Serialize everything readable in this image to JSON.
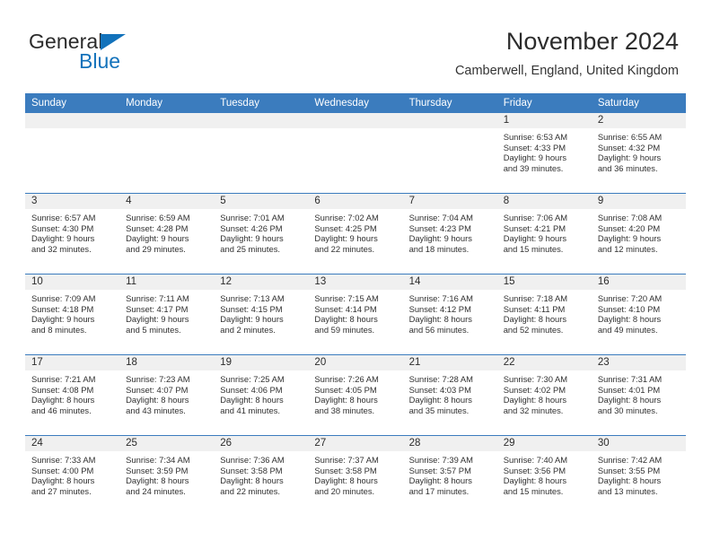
{
  "brand": {
    "name_part1": "General",
    "name_part2": "Blue",
    "logo_icon": "triangle-flag-icon",
    "accent_color": "#1272bb"
  },
  "header": {
    "title": "November 2024",
    "subtitle": "Camberwell, England, United Kingdom"
  },
  "calendar": {
    "header_bg_color": "#3b7cbe",
    "daynum_bg_color": "#f0f0f0",
    "weekday_headers": [
      "Sunday",
      "Monday",
      "Tuesday",
      "Wednesday",
      "Thursday",
      "Friday",
      "Saturday"
    ],
    "weeks": [
      [
        {
          "day": "",
          "details": ""
        },
        {
          "day": "",
          "details": ""
        },
        {
          "day": "",
          "details": ""
        },
        {
          "day": "",
          "details": ""
        },
        {
          "day": "",
          "details": ""
        },
        {
          "day": "1",
          "details": "Sunrise: 6:53 AM\nSunset: 4:33 PM\nDaylight: 9 hours\nand 39 minutes."
        },
        {
          "day": "2",
          "details": "Sunrise: 6:55 AM\nSunset: 4:32 PM\nDaylight: 9 hours\nand 36 minutes."
        }
      ],
      [
        {
          "day": "3",
          "details": "Sunrise: 6:57 AM\nSunset: 4:30 PM\nDaylight: 9 hours\nand 32 minutes."
        },
        {
          "day": "4",
          "details": "Sunrise: 6:59 AM\nSunset: 4:28 PM\nDaylight: 9 hours\nand 29 minutes."
        },
        {
          "day": "5",
          "details": "Sunrise: 7:01 AM\nSunset: 4:26 PM\nDaylight: 9 hours\nand 25 minutes."
        },
        {
          "day": "6",
          "details": "Sunrise: 7:02 AM\nSunset: 4:25 PM\nDaylight: 9 hours\nand 22 minutes."
        },
        {
          "day": "7",
          "details": "Sunrise: 7:04 AM\nSunset: 4:23 PM\nDaylight: 9 hours\nand 18 minutes."
        },
        {
          "day": "8",
          "details": "Sunrise: 7:06 AM\nSunset: 4:21 PM\nDaylight: 9 hours\nand 15 minutes."
        },
        {
          "day": "9",
          "details": "Sunrise: 7:08 AM\nSunset: 4:20 PM\nDaylight: 9 hours\nand 12 minutes."
        }
      ],
      [
        {
          "day": "10",
          "details": "Sunrise: 7:09 AM\nSunset: 4:18 PM\nDaylight: 9 hours\nand 8 minutes."
        },
        {
          "day": "11",
          "details": "Sunrise: 7:11 AM\nSunset: 4:17 PM\nDaylight: 9 hours\nand 5 minutes."
        },
        {
          "day": "12",
          "details": "Sunrise: 7:13 AM\nSunset: 4:15 PM\nDaylight: 9 hours\nand 2 minutes."
        },
        {
          "day": "13",
          "details": "Sunrise: 7:15 AM\nSunset: 4:14 PM\nDaylight: 8 hours\nand 59 minutes."
        },
        {
          "day": "14",
          "details": "Sunrise: 7:16 AM\nSunset: 4:12 PM\nDaylight: 8 hours\nand 56 minutes."
        },
        {
          "day": "15",
          "details": "Sunrise: 7:18 AM\nSunset: 4:11 PM\nDaylight: 8 hours\nand 52 minutes."
        },
        {
          "day": "16",
          "details": "Sunrise: 7:20 AM\nSunset: 4:10 PM\nDaylight: 8 hours\nand 49 minutes."
        }
      ],
      [
        {
          "day": "17",
          "details": "Sunrise: 7:21 AM\nSunset: 4:08 PM\nDaylight: 8 hours\nand 46 minutes."
        },
        {
          "day": "18",
          "details": "Sunrise: 7:23 AM\nSunset: 4:07 PM\nDaylight: 8 hours\nand 43 minutes."
        },
        {
          "day": "19",
          "details": "Sunrise: 7:25 AM\nSunset: 4:06 PM\nDaylight: 8 hours\nand 41 minutes."
        },
        {
          "day": "20",
          "details": "Sunrise: 7:26 AM\nSunset: 4:05 PM\nDaylight: 8 hours\nand 38 minutes."
        },
        {
          "day": "21",
          "details": "Sunrise: 7:28 AM\nSunset: 4:03 PM\nDaylight: 8 hours\nand 35 minutes."
        },
        {
          "day": "22",
          "details": "Sunrise: 7:30 AM\nSunset: 4:02 PM\nDaylight: 8 hours\nand 32 minutes."
        },
        {
          "day": "23",
          "details": "Sunrise: 7:31 AM\nSunset: 4:01 PM\nDaylight: 8 hours\nand 30 minutes."
        }
      ],
      [
        {
          "day": "24",
          "details": "Sunrise: 7:33 AM\nSunset: 4:00 PM\nDaylight: 8 hours\nand 27 minutes."
        },
        {
          "day": "25",
          "details": "Sunrise: 7:34 AM\nSunset: 3:59 PM\nDaylight: 8 hours\nand 24 minutes."
        },
        {
          "day": "26",
          "details": "Sunrise: 7:36 AM\nSunset: 3:58 PM\nDaylight: 8 hours\nand 22 minutes."
        },
        {
          "day": "27",
          "details": "Sunrise: 7:37 AM\nSunset: 3:58 PM\nDaylight: 8 hours\nand 20 minutes."
        },
        {
          "day": "28",
          "details": "Sunrise: 7:39 AM\nSunset: 3:57 PM\nDaylight: 8 hours\nand 17 minutes."
        },
        {
          "day": "29",
          "details": "Sunrise: 7:40 AM\nSunset: 3:56 PM\nDaylight: 8 hours\nand 15 minutes."
        },
        {
          "day": "30",
          "details": "Sunrise: 7:42 AM\nSunset: 3:55 PM\nDaylight: 8 hours\nand 13 minutes."
        }
      ]
    ]
  }
}
